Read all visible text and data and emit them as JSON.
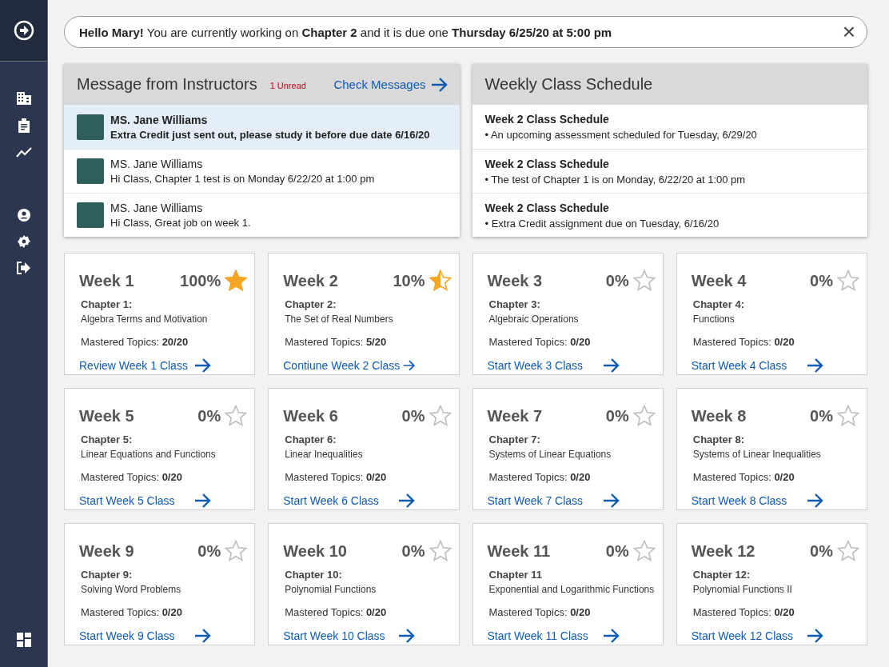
{
  "sidebar": {
    "items": [
      {
        "kind": "building"
      },
      {
        "kind": "clipboard"
      },
      {
        "kind": "chart"
      },
      {
        "kind": "gap"
      },
      {
        "kind": "user"
      },
      {
        "kind": "settings"
      },
      {
        "kind": "logout"
      }
    ]
  },
  "banner": {
    "text": "**Hello Mary!** You are currently working on **Chapter 2** and it is due one **Thursday 6/25/20 at 5:00 pm**",
    "close": "×"
  },
  "messages": {
    "title": "Message from Instructors",
    "unread_badge": "1 Unread",
    "action": "Check Messages",
    "items": [
      {
        "sender": "MS. Jane Williams",
        "text": "Extra Credit just sent out, please study it before due date 6/16/20",
        "unread": true
      },
      {
        "sender": "MS. Jane Williams",
        "text": "Hi Class, Chapter 1 test is on Monday 6/22/20 at 1:00 pm",
        "unread": false
      },
      {
        "sender": "MS. Jane Williams",
        "text": "Hi Class, Great job on week 1.",
        "unread": false
      }
    ]
  },
  "schedule": {
    "title": "Weekly Class Schedule",
    "items": [
      {
        "title": "Week 2 Class Schedule",
        "text": "• An upcoming assessment scheduled for Tuesday, 6/29/20"
      },
      {
        "title": "Week 2 Class Schedule",
        "text": "• The test of Chapter 1 is on Monday, 6/22/20 at 1:00 pm"
      },
      {
        "title": "Week 2 Class Schedule",
        "text": "• Extra Credit assignment due on Tuesday, 6/16/20"
      }
    ]
  },
  "weeks": [
    {
      "title": "Week 1",
      "percent": "100%",
      "kind": "full",
      "chapter": "Chapter 1:",
      "topic": "Algebra Terms and Motivation",
      "mastered": "Mastered Topics: **20/20**",
      "link": "Review Week 1 Class"
    },
    {
      "title": "Week 2",
      "percent": "10%",
      "kind": "half",
      "chapter": "Chapter 2:",
      "topic": "The Set of Real Numbers",
      "mastered": "Mastered Topics: **5/20**",
      "link": "Contiune Week 2 Class"
    },
    {
      "title": "Week 3",
      "percent": "0%",
      "kind": "empty",
      "chapter": "Chapter 3:",
      "topic": "Algebraic Operations",
      "mastered": "Mastered Topics: **0/20**",
      "link": "Start Week 3 Class"
    },
    {
      "title": "Week 4",
      "percent": "0%",
      "kind": "empty",
      "chapter": "Chapter 4:",
      "topic": "Functions",
      "mastered": "Mastered Topics: **0/20**",
      "link": "Start Week 4 Class"
    },
    {
      "title": "Week 5",
      "percent": "0%",
      "kind": "empty",
      "chapter": "Chapter 5:",
      "topic": "Linear Equations and Functions",
      "mastered": "Mastered Topics: **0/20**",
      "link": "Start Week 5 Class"
    },
    {
      "title": "Week 6",
      "percent": "0%",
      "kind": "empty",
      "chapter": "Chapter 6:",
      "topic": "Linear Inequalities",
      "mastered": "Mastered Topics: **0/20**",
      "link": "Start Week 6 Class"
    },
    {
      "title": "Week 7",
      "percent": "0%",
      "kind": "empty",
      "chapter": "Chapter 7:",
      "topic": "Systems of Linear Equations",
      "mastered": "Mastered Topics: **0/20**",
      "link": "Start Week 7 Class"
    },
    {
      "title": "Week 8",
      "percent": "0%",
      "kind": "empty",
      "chapter": "Chapter 8:",
      "topic": "Systems of Linear Inequalities",
      "mastered": "Mastered Topics: **0/20**",
      "link": "Start Week 8 Class"
    },
    {
      "title": "Week 9",
      "percent": "0%",
      "kind": "empty",
      "chapter": "Chapter 9:",
      "topic": "Solving Word Problems",
      "mastered": "Mastered Topics: **0/20**",
      "link": "Start Week 9 Class"
    },
    {
      "title": "Week 10",
      "percent": "0%",
      "kind": "empty",
      "chapter": "Chapter 10:",
      "topic": "Polynomial Functions",
      "mastered": "Mastered Topics: **0/20**",
      "link": "Start Week 10 Class"
    },
    {
      "title": "Week 11",
      "percent": "0%",
      "kind": "empty",
      "chapter": "Chapter 11",
      "topic": "Exponential and Logarithmic Functions",
      "mastered": "Mastered Topics: **0/20**",
      "link": "Start Week 11 Class"
    },
    {
      "title": "Week 12",
      "percent": "0%",
      "kind": "empty",
      "chapter": "Chapter 12:",
      "topic": "Polynomial Functions II",
      "mastered": "Mastered Topics: **0/20**",
      "link": "Start Week 12 Class"
    }
  ]
}
